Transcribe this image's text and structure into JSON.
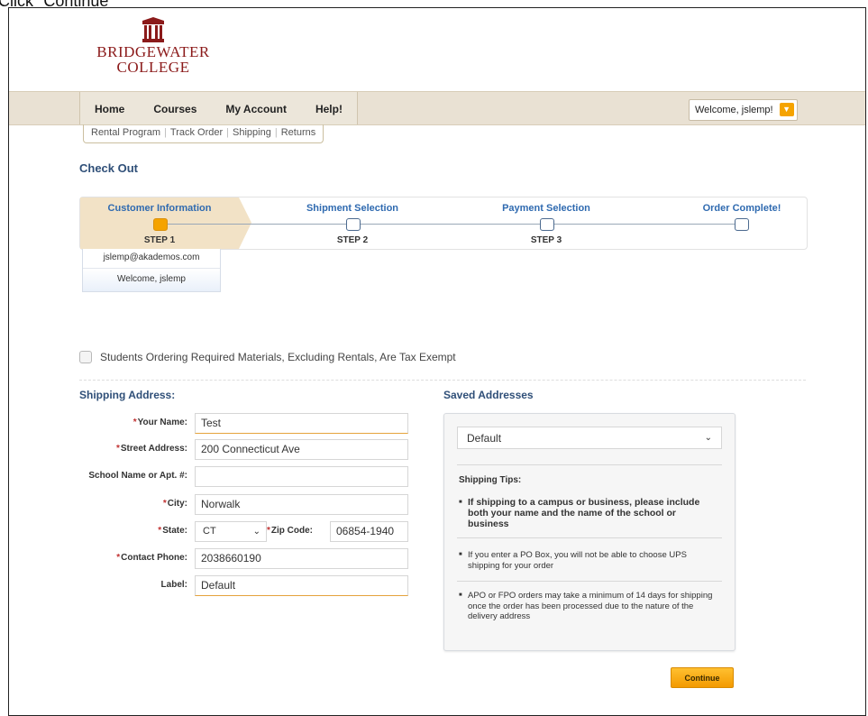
{
  "caption": "Click \"Continue\"",
  "logo": {
    "line1": "BRIDGEWATER",
    "line2": "COLLEGE"
  },
  "nav": {
    "tabs": [
      "Home",
      "Courses",
      "My Account",
      "Help!"
    ],
    "welcome": "Welcome, jslemp!"
  },
  "subnav": {
    "links": [
      "Rental Program",
      "Track Order",
      "Shipping",
      "Returns"
    ]
  },
  "checkout": {
    "title": "Check Out"
  },
  "steps": [
    {
      "name": "Customer Information",
      "num": "STEP 1"
    },
    {
      "name": "Shipment Selection",
      "num": "STEP 2"
    },
    {
      "name": "Payment Selection",
      "num": "STEP 3"
    },
    {
      "name": "Order Complete!",
      "num": ""
    }
  ],
  "user": {
    "email": "jslemp@akademos.com",
    "welcome": "Welcome, jslemp"
  },
  "tax": {
    "label": "Students Ordering Required Materials, Excluding Rentals, Are Tax Exempt"
  },
  "shipping": {
    "title": "Shipping Address:",
    "labels": {
      "name": "Your Name:",
      "street": "Street Address:",
      "school": "School Name or Apt. #:",
      "city": "City:",
      "state": "State:",
      "zip": "Zip Code:",
      "phone": "Contact Phone:",
      "label": "Label:"
    },
    "values": {
      "name": "Test",
      "street": "200 Connecticut Ave",
      "school": "",
      "city": "Norwalk",
      "state": "CT",
      "zip": "06854-1940",
      "phone": "2038660190",
      "label": "Default"
    }
  },
  "saved": {
    "title": "Saved Addresses",
    "selected": "Default",
    "tips_title": "Shipping Tips:",
    "tips": [
      "If shipping to a campus or business, please include both your name and the name of the school or business",
      "If you enter a PO Box, you will not be able to choose UPS shipping for your order",
      "APO or FPO orders may take a minimum of 14 days for shipping once the order has been processed due to the nature of the delivery address"
    ]
  },
  "actions": {
    "continue": "Continue"
  },
  "colors": {
    "accent": "#f5a300",
    "brand": "#8b1a1a",
    "heading": "#2f4f78"
  }
}
